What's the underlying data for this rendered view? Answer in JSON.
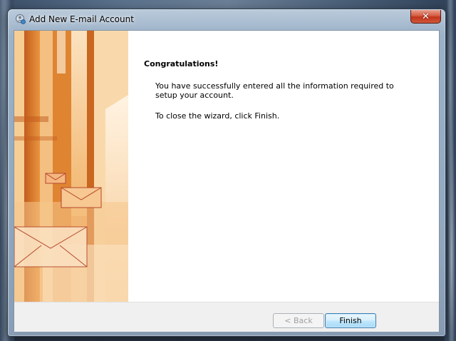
{
  "window": {
    "title": "Add New E-mail Account",
    "close_label": "✕",
    "icon": "outlook-account-icon"
  },
  "content": {
    "heading": "Congratulations!",
    "message": "You have successfully entered all the information required to setup your account.",
    "instruction": "To close the wizard, click Finish."
  },
  "buttons": {
    "back": "< Back",
    "finish": "Finish"
  },
  "banner": {
    "icon": "envelope-icon",
    "colors": {
      "orange": "#e9963f",
      "light": "#f7d3a2"
    }
  }
}
